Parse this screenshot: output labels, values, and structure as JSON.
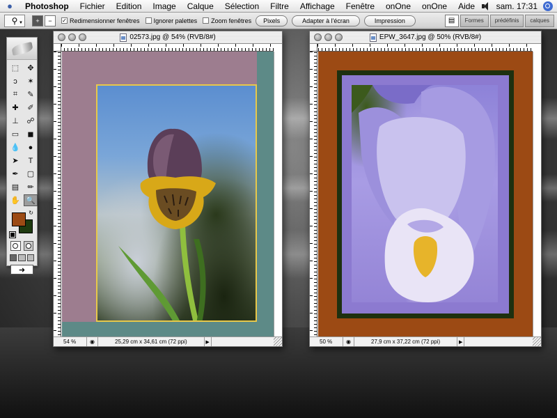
{
  "menubar": {
    "app_name": "Photoshop",
    "items": [
      "Fichier",
      "Edition",
      "Image",
      "Calque",
      "Sélection",
      "Filtre",
      "Affichage",
      "Fenêtre",
      "onOne",
      "onOne",
      "Aide"
    ],
    "clock": "sam. 17:31"
  },
  "options_bar": {
    "tool_preset_icon": "zoom-icon",
    "checkboxes": [
      {
        "label": "Redimensionner fenêtres",
        "checked": true
      },
      {
        "label": "Ignorer palettes",
        "checked": false
      },
      {
        "label": "Zoom fenêtres",
        "checked": false
      }
    ],
    "buttons": [
      "Pixels",
      "Adapter à l'écran",
      "Impression"
    ],
    "palette_tabs": [
      "Formes",
      "prédéfinis",
      "calques"
    ]
  },
  "toolbox": {
    "tools": [
      "marquee-icon",
      "move-icon",
      "lasso-icon",
      "magic-wand-icon",
      "crop-icon",
      "slice-icon",
      "healing-icon",
      "brush-icon",
      "stamp-icon",
      "history-brush-icon",
      "eraser-icon",
      "gradient-icon",
      "blur-icon",
      "dodge-icon",
      "path-select-icon",
      "type-icon",
      "pen-icon",
      "shape-icon",
      "notes-icon",
      "eyedropper-icon",
      "hand-icon",
      "zoom-icon"
    ],
    "tool_glyphs": [
      "⬚",
      "✥",
      "ↄ",
      "✶",
      "⌗",
      "✎",
      "✚",
      "✐",
      "⊥",
      "☍",
      "▭",
      "◼",
      "💧",
      "●",
      "➤",
      "T",
      "✒",
      "▢",
      "▤",
      "✏",
      "✋",
      "🔍"
    ],
    "selected_tool": "zoom-icon",
    "foreground_color": "#9c4a14",
    "background_color": "#1e3a10"
  },
  "documents": [
    {
      "title": "02573.jpg @ 54% (RVB/8#)",
      "zoom": "54 %",
      "info": "25,29 cm x 34,61 cm (72 ppi)",
      "colors": {
        "outer": "#9d7d8f",
        "frame": "#5d8a87",
        "border": "#e8c84a"
      }
    },
    {
      "title": "EPW_3647.jpg @ 50% (RVB/8#)",
      "zoom": "50 %",
      "info": "27,9 cm x 37,22 cm (72 ppi)",
      "colors": {
        "outer": "#9c4a14",
        "frame": "#1e3010",
        "mat": "#8c7ad0"
      }
    }
  ]
}
